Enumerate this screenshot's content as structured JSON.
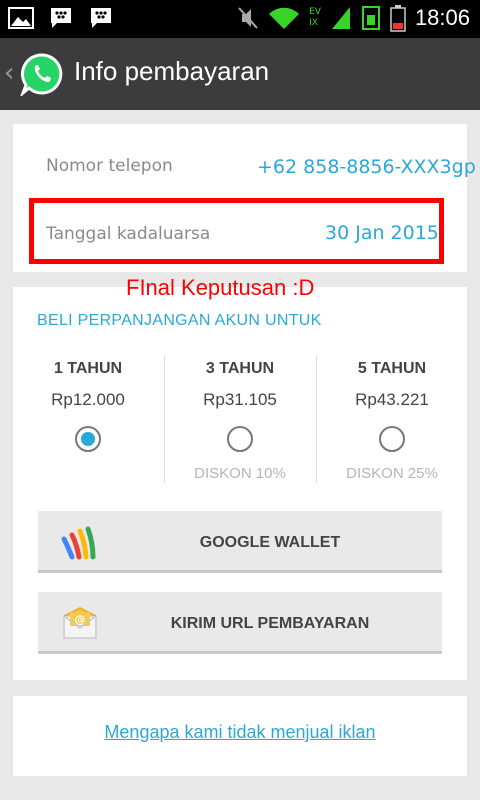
{
  "status_bar": {
    "time": "18:06",
    "network_label_top": "EV",
    "network_label_bottom": "IX"
  },
  "action_bar": {
    "title": "Info pembayaran"
  },
  "account": {
    "phone_label": "Nomor telepon",
    "phone_value": "+62 858-8856-XXX3gp",
    "expiry_label": "Tanggal kadaluarsa",
    "expiry_value": "30 Jan 2015"
  },
  "annotation": "FInal Keputusan :D",
  "renewal": {
    "heading": "BELI PERPANJANGAN AKUN UNTUK",
    "plans": [
      {
        "name": "1 TAHUN",
        "price": "Rp12.000",
        "discount": "",
        "selected": true
      },
      {
        "name": "3 TAHUN",
        "price": "Rp31.105",
        "discount": "DISKON 10%",
        "selected": false
      },
      {
        "name": "5 TAHUN",
        "price": "Rp43.221",
        "discount": "DISKON 25%",
        "selected": false
      }
    ],
    "google_wallet_label": "GOOGLE WALLET",
    "send_url_label": "KIRIM URL PEMBAYARAN"
  },
  "footer": {
    "link_text": "Mengapa kami tidak menjual iklan"
  },
  "colors": {
    "accent": "#2aa8d8",
    "annotation_red": "#ff0000",
    "action_bar": "#3c3c3c",
    "whatsapp_green": "#25d366"
  }
}
